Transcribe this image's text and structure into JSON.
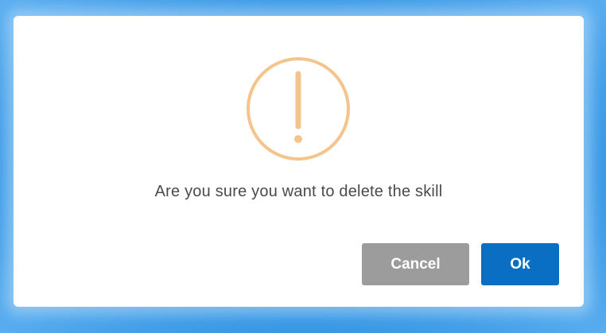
{
  "dialog": {
    "icon": "warning-exclamation-icon",
    "message": "Are you sure you want to delete the skill",
    "cancel_label": "Cancel",
    "ok_label": "Ok"
  },
  "colors": {
    "icon": "#f5c48a",
    "cancel": "#9c9c9c",
    "ok": "#0a6fc2",
    "backdrop": "#2b8fe0"
  }
}
